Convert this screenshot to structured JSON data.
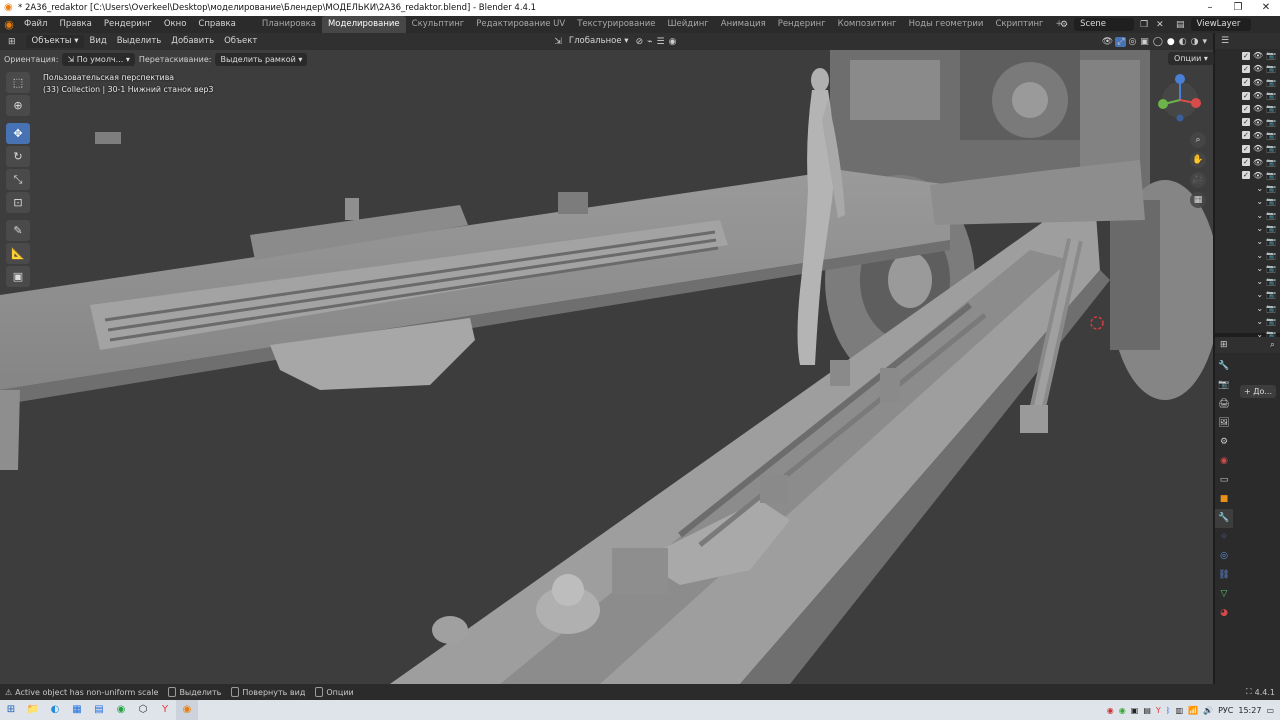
{
  "titlebar": {
    "title": "* 2A36_redaktor [C:\\Users\\Overkeel\\Desktop\\моделирование\\Блендер\\МОДЕЛЬКИ\\2A36_redaktor.blend] - Blender 4.4.1"
  },
  "menu": [
    "Файл",
    "Правка",
    "Рендеринг",
    "Окно",
    "Справка"
  ],
  "workspaces": {
    "tabs": [
      "Планировка",
      "Моделирование",
      "Скульптинг",
      "Редактирование UV",
      "Текстурирование",
      "Шейдинг",
      "Анимация",
      "Рендеринг",
      "Композитинг",
      "Ноды геометрии",
      "Скриптинг"
    ],
    "active": "Моделирование",
    "add": "+"
  },
  "scene": {
    "label": "Scene"
  },
  "viewlayer": {
    "label": "ViewLayer"
  },
  "viewport_header": {
    "mode": "Объекты",
    "view": "Вид",
    "select": "Выделить",
    "add": "Добавить",
    "object": "Объект",
    "transform_orientation": "Глобальное"
  },
  "tool_options": {
    "orientation_label": "Ориентация:",
    "orientation_value": "По умолч...",
    "drag_label": "Перетаскивание:",
    "drag_value": "Выделить рамкой",
    "options_button": "Опции"
  },
  "viewport_info": {
    "line1": "Пользовательская перспектива",
    "line2": "(33) Collection | 30-1 Нижний станок вер3"
  },
  "properties": {
    "add_modifier": "+ До..."
  },
  "outliner_rows": 22,
  "status": {
    "warning": "Active object has non-uniform scale",
    "select": "Выделить",
    "rotate": "Повернуть вид",
    "options": "Опции",
    "version": "4.4.1"
  },
  "taskbar": {
    "lang": "РУС",
    "time": "15:27"
  },
  "colors": {
    "accent_blue": "#4772b3",
    "blender_orange": "#e87d0d",
    "viewport_bg": "#3d3d3d"
  }
}
